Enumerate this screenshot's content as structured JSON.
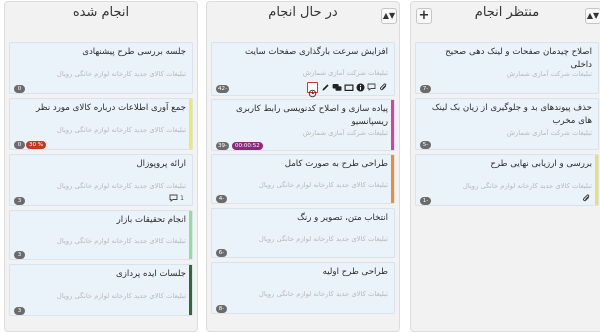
{
  "columns": {
    "todo": {
      "title": "منتظر انجام",
      "cards": [
        {
          "title": "اصلاح چیدمان صفحات و لینک دهی صحیح داخلی",
          "subtitle": "تبلیغات شرکت آمازی شمارش",
          "badge": "7-",
          "bar_color": ""
        },
        {
          "title": "حذف پیوندهای بد و جلوگیری از زیان بک لینک های مخرب",
          "subtitle": "تبلیغات شرکت آمازی شمارش",
          "badge": "5-",
          "bar_color": ""
        },
        {
          "title": "بررسی و ارزیابی نهایی طرح",
          "subtitle": "تبلیغات کالای جدید کارخانه لوازم خانگی رویال",
          "badge": "1-",
          "bar_color": "#f0e05a"
        }
      ]
    },
    "doing": {
      "title": "در حال انجام",
      "cards": [
        {
          "title": "افزایش سرعت بارگذاری صفحات سایت",
          "subtitle": "تبلیغات شرکت آمازی شمارش",
          "badge": "42-",
          "bar_color": ""
        },
        {
          "title": "پیاده سازی و اصلاح کدنویسی رابط کاربری ریسپانسیو",
          "subtitle": "تبلیغات شرکت آمازی شمارش",
          "badge": "39-",
          "timer": "00:00:52",
          "bar_color": "#e23aa3"
        },
        {
          "title": "طراحی طرح به صورت کامل",
          "subtitle": "تبلیغات کالای جدید کارخانه لوازم خانگی رویال",
          "badge": "4-",
          "bar_color": "#f08c2c"
        },
        {
          "title": "انتخاب متن، تصویر و رنگ",
          "subtitle": "تبلیغات کالای جدید کارخانه لوازم خانگی رویال",
          "badge": "6-",
          "bar_color": ""
        },
        {
          "title": "طراحی طرح اولیه",
          "subtitle": "تبلیغات کالای جدید کارخانه لوازم خانگی رویال",
          "badge": "8-",
          "bar_color": ""
        }
      ]
    },
    "done": {
      "title": "انجام شده",
      "cards": [
        {
          "title": "جلسه بررسی طرح پیشنهادی",
          "subtitle": "تبلیغات کالای جدید کارخانه لوازم خانگی رویال",
          "badge": "0",
          "bar_color": ""
        },
        {
          "title": "جمع آوری اطلاعات درباره کالای مورد نظر",
          "subtitle": "تبلیغات کالای جدید کارخانه لوازم خانگی رویال",
          "badge": "0",
          "progress_label": "30 %",
          "progress": 0.3,
          "bar_color": "#f3ea4c"
        },
        {
          "title": "ارائه پروپوزال",
          "subtitle": "تبلیغات کالای جدید کارخانه لوازم خانگی رویال",
          "badge": "3",
          "comments": "1",
          "bar_color": ""
        },
        {
          "title": "انجام تحقیقات بازار",
          "subtitle": "تبلیغات کالای جدید کارخانه لوازم خانگی رویال",
          "badge": "3",
          "bar_color": "#8fe08f"
        },
        {
          "title": "جلسات ایده پردازی",
          "subtitle": "تبلیغات کالای جدید کارخانه لوازم خانگی رویال",
          "badge": "3",
          "bar_color": "#2f6b2a"
        }
      ]
    }
  },
  "header_buttons": {
    "sort_icon": "sort-icon",
    "add_icon": "plus-icon",
    "add_label": "+",
    "sort_label": "▲▼"
  },
  "colors": {
    "badge": "#6b6b6b",
    "timer": "#8b2a7a",
    "progress": "#c0392b",
    "card": "#eaf2fa"
  }
}
